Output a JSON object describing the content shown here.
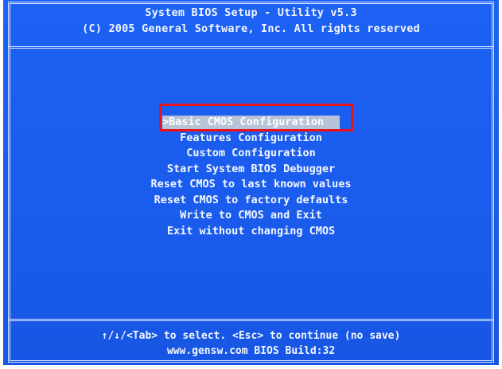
{
  "header": {
    "title": "System BIOS Setup - Utility v5.3",
    "copyright": "(C) 2005 General Software, Inc. All rights reserved"
  },
  "menu": {
    "selected_marker": ">",
    "items": [
      {
        "label": "Basic CMOS Configuration",
        "selected": true
      },
      {
        "label": "Features Configuration",
        "selected": false
      },
      {
        "label": "Custom Configuration",
        "selected": false
      },
      {
        "label": "Start System BIOS Debugger",
        "selected": false
      },
      {
        "label": "Reset CMOS to last known values",
        "selected": false
      },
      {
        "label": "Reset CMOS to factory defaults",
        "selected": false
      },
      {
        "label": "Write to CMOS and Exit",
        "selected": false
      },
      {
        "label": "Exit without changing CMOS",
        "selected": false
      }
    ]
  },
  "footer": {
    "help": "↑/↓/<Tab> to select.  <Esc> to continue (no save)",
    "build": "www.gensw.com BIOS Build:32"
  },
  "colors": {
    "background": "#1a5ef0",
    "text": "#ffffff",
    "selection": "#b7c3d6",
    "annotation_box": "#e8121c"
  }
}
